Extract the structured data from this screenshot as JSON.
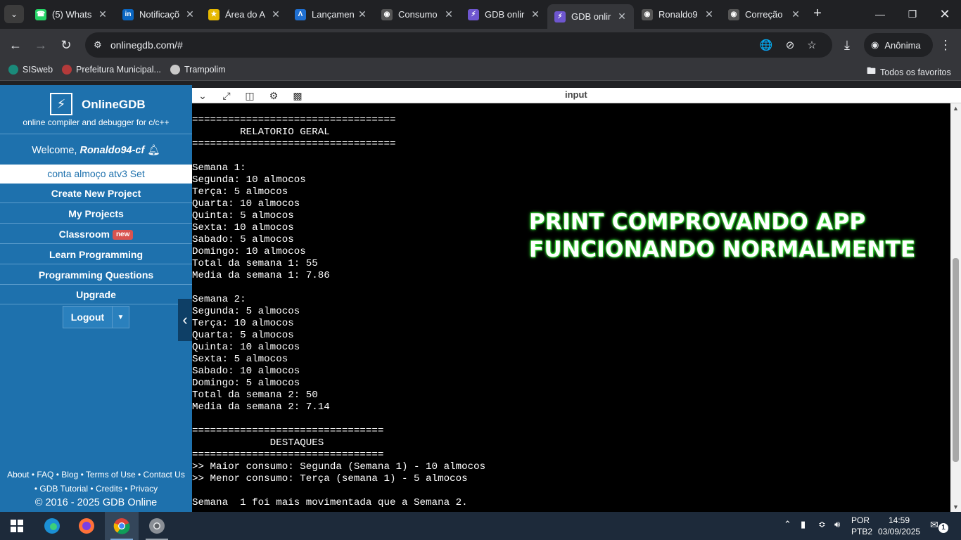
{
  "browser": {
    "tabs": [
      {
        "title": "(5) Whats",
        "icon": "whatsapp-icon",
        "color": "#25d366"
      },
      {
        "title": "Notificaçõ",
        "icon": "linkedin-icon",
        "color": "#0a66c2"
      },
      {
        "title": "Área do A",
        "icon": "star-outline-icon",
        "color": "#e6b800"
      },
      {
        "title": "Lançamen",
        "icon": "app-icon",
        "color": "#1f6fd1"
      },
      {
        "title": "Consumo",
        "icon": "github-icon",
        "color": "#555555"
      },
      {
        "title": "GDB onlir",
        "icon": "bolt-icon",
        "color": "#6e56cf"
      },
      {
        "title": "GDB onlir",
        "icon": "bolt-icon",
        "color": "#6e56cf"
      },
      {
        "title": "Ronaldo9",
        "icon": "github-icon",
        "color": "#555555"
      },
      {
        "title": "Correção",
        "icon": "github-icon",
        "color": "#555555"
      }
    ],
    "url": "onlinegdb.com/#",
    "profile_label": "Anônima",
    "bookmarks": [
      {
        "label": "SISweb"
      },
      {
        "label": "Prefeitura Municipal..."
      },
      {
        "label": "Trampolim"
      }
    ],
    "all_bookmarks": "Todos os favoritos"
  },
  "sidebar": {
    "brand": "OnlineGDB",
    "tagline": "online compiler and debugger for c/c++",
    "welcome_prefix": "Welcome, ",
    "username": "Ronaldo94-cf",
    "project_name": "conta almoço atv3 Set",
    "menu": [
      {
        "label": "Create New Project"
      },
      {
        "label": "My Projects"
      },
      {
        "label": "Classroom",
        "badge": "new"
      },
      {
        "label": "Learn Programming"
      },
      {
        "label": "Programming Questions"
      },
      {
        "label": "Upgrade"
      }
    ],
    "logout": "Logout",
    "footer_line1": "About • FAQ • Blog • Terms of Use • Contact Us",
    "footer_line2": "• GDB Tutorial • Credits • Privacy",
    "copyright": "© 2016 - 2025 GDB Online"
  },
  "panel": {
    "title": "input"
  },
  "console_lines": [
    "==================================",
    "        RELATORIO GERAL",
    "==================================",
    "",
    "Semana 1:",
    "Segunda: 10 almocos",
    "Terça: 5 almocos",
    "Quarta: 10 almocos",
    "Quinta: 5 almocos",
    "Sexta: 10 almocos",
    "Sabado: 5 almocos",
    "Domingo: 10 almocos",
    "Total da semana 1: 55",
    "Media da semana 1: 7.86",
    "",
    "Semana 2:",
    "Segunda: 5 almocos",
    "Terça: 10 almocos",
    "Quarta: 5 almocos",
    "Quinta: 10 almocos",
    "Sexta: 5 almocos",
    "Sabado: 10 almocos",
    "Domingo: 5 almocos",
    "Total da semana 2: 50",
    "Media da semana 2: 7.14",
    "",
    "================================",
    "             DESTAQUES",
    "================================",
    ">> Maior consumo: Segunda (Semana 1) - 10 almocos",
    ">> Menor consumo: Terça (semana 1) - 5 almocos",
    "",
    "Semana  1 foi mais movimentada que a Semana 2."
  ],
  "overlay": {
    "line1": "PRINT COMPROVANDO APP",
    "line2": "FUNCIONANDO NORMALMENTE"
  },
  "taskbar": {
    "lang1": "POR",
    "lang2": "PTB2",
    "time": "14:59",
    "date": "03/09/2025",
    "notifications": "1"
  }
}
